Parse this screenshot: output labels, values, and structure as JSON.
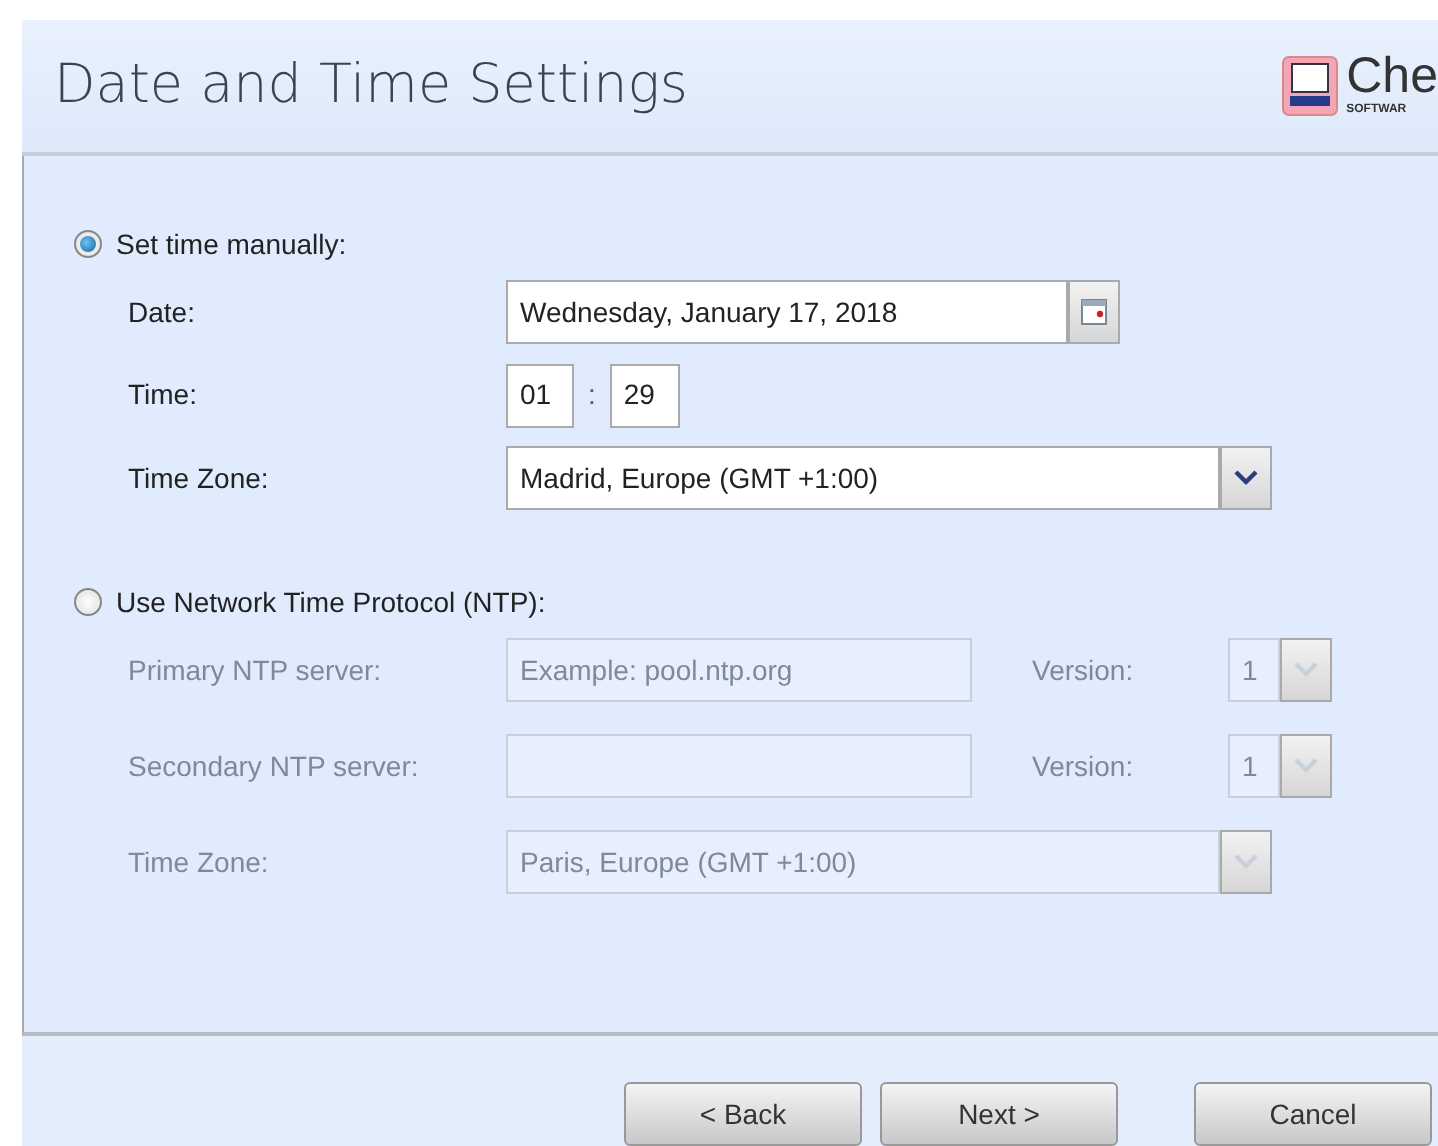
{
  "header": {
    "title": "Date and Time Settings",
    "logo_text": "Che",
    "logo_subtext": "SOFTWAR"
  },
  "manual": {
    "label": "Set time manually:",
    "selected": true,
    "disabled": false,
    "date": {
      "label": "Date:",
      "value": "Wednesday, January 17, 2018"
    },
    "time": {
      "label": "Time:",
      "hours": "01",
      "separator": ":",
      "minutes": "29"
    },
    "time_zone": {
      "label": "Time Zone:",
      "value": "Madrid, Europe (GMT +1:00)"
    }
  },
  "ntp": {
    "label": "Use Network Time Protocol (NTP):",
    "selected": false,
    "disabled": true,
    "servers": [
      {
        "label": "Primary NTP server:",
        "placeholder": "Example: pool.ntp.org",
        "version_label": "Version:",
        "version": "1"
      },
      {
        "label": "Secondary NTP server:",
        "version_label": "Version:",
        "version": "1"
      }
    ],
    "time_zone": {
      "label": "Time Zone:",
      "value": "Paris, Europe (GMT +1:00)"
    }
  },
  "buttons": [
    {
      "label": "< Back",
      "kind": "back"
    },
    {
      "label": "Next >",
      "kind": "next"
    },
    {
      "label": "Cancel",
      "kind": "cancel"
    }
  ]
}
